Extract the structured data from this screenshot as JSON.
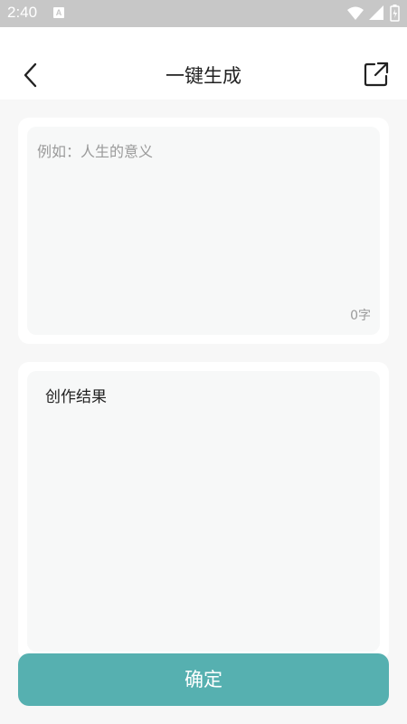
{
  "status_bar": {
    "time": "2:40",
    "notification_icon_letter": "A",
    "icons": [
      "wifi-icon",
      "signal-icon",
      "battery-icon"
    ]
  },
  "app_bar": {
    "title": "一键生成",
    "left_icon": "back-arrow-icon",
    "right_icon": "share-external-icon"
  },
  "input_card": {
    "placeholder": "例如：人生的意义",
    "char_count": "0字"
  },
  "result_card": {
    "label": "创作结果"
  },
  "confirm_button": {
    "label": "确定"
  },
  "colors": {
    "status_bar": "#c7c7c7",
    "background": "#f7f7f7",
    "card": "#ffffff",
    "inner_field": "#f7f8f8",
    "accent": "#56b0b0",
    "text_primary": "#222222",
    "text_hint": "#9a9a9a"
  }
}
